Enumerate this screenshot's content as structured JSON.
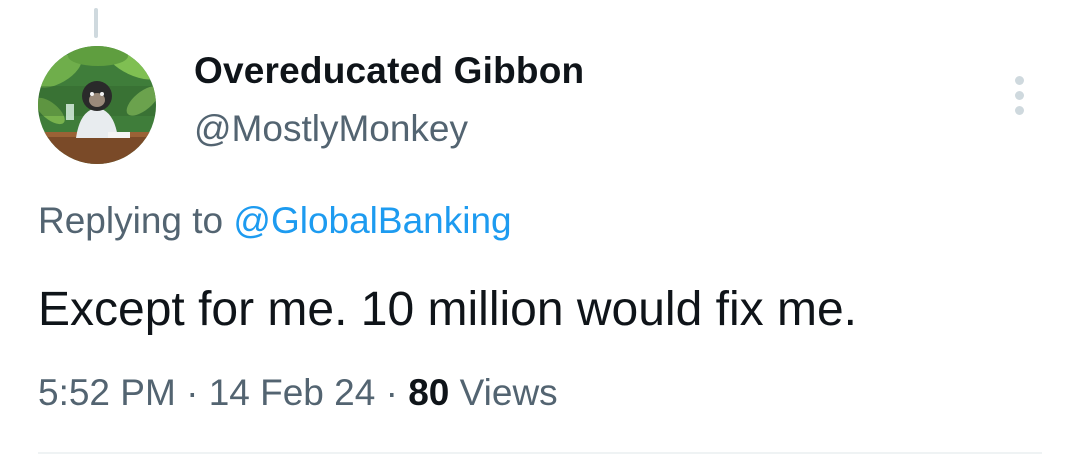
{
  "tweet": {
    "author_name": "Overeducated Gibbon",
    "author_handle": "@MostlyMonkey",
    "replying_prefix": "Replying to ",
    "replying_to": "@GlobalBanking",
    "text": "Except for me. 10 million would fix me.",
    "time": "5:52 PM",
    "separator": " · ",
    "date": "14 Feb 24",
    "views_count": "80",
    "views_label": " Views"
  },
  "icons": {
    "avatar": "gibbon-avatar-image",
    "more": "more-vertical-icon"
  },
  "colors": {
    "text": "#0f1419",
    "secondary": "#536471",
    "accent": "#1d9bf0"
  }
}
